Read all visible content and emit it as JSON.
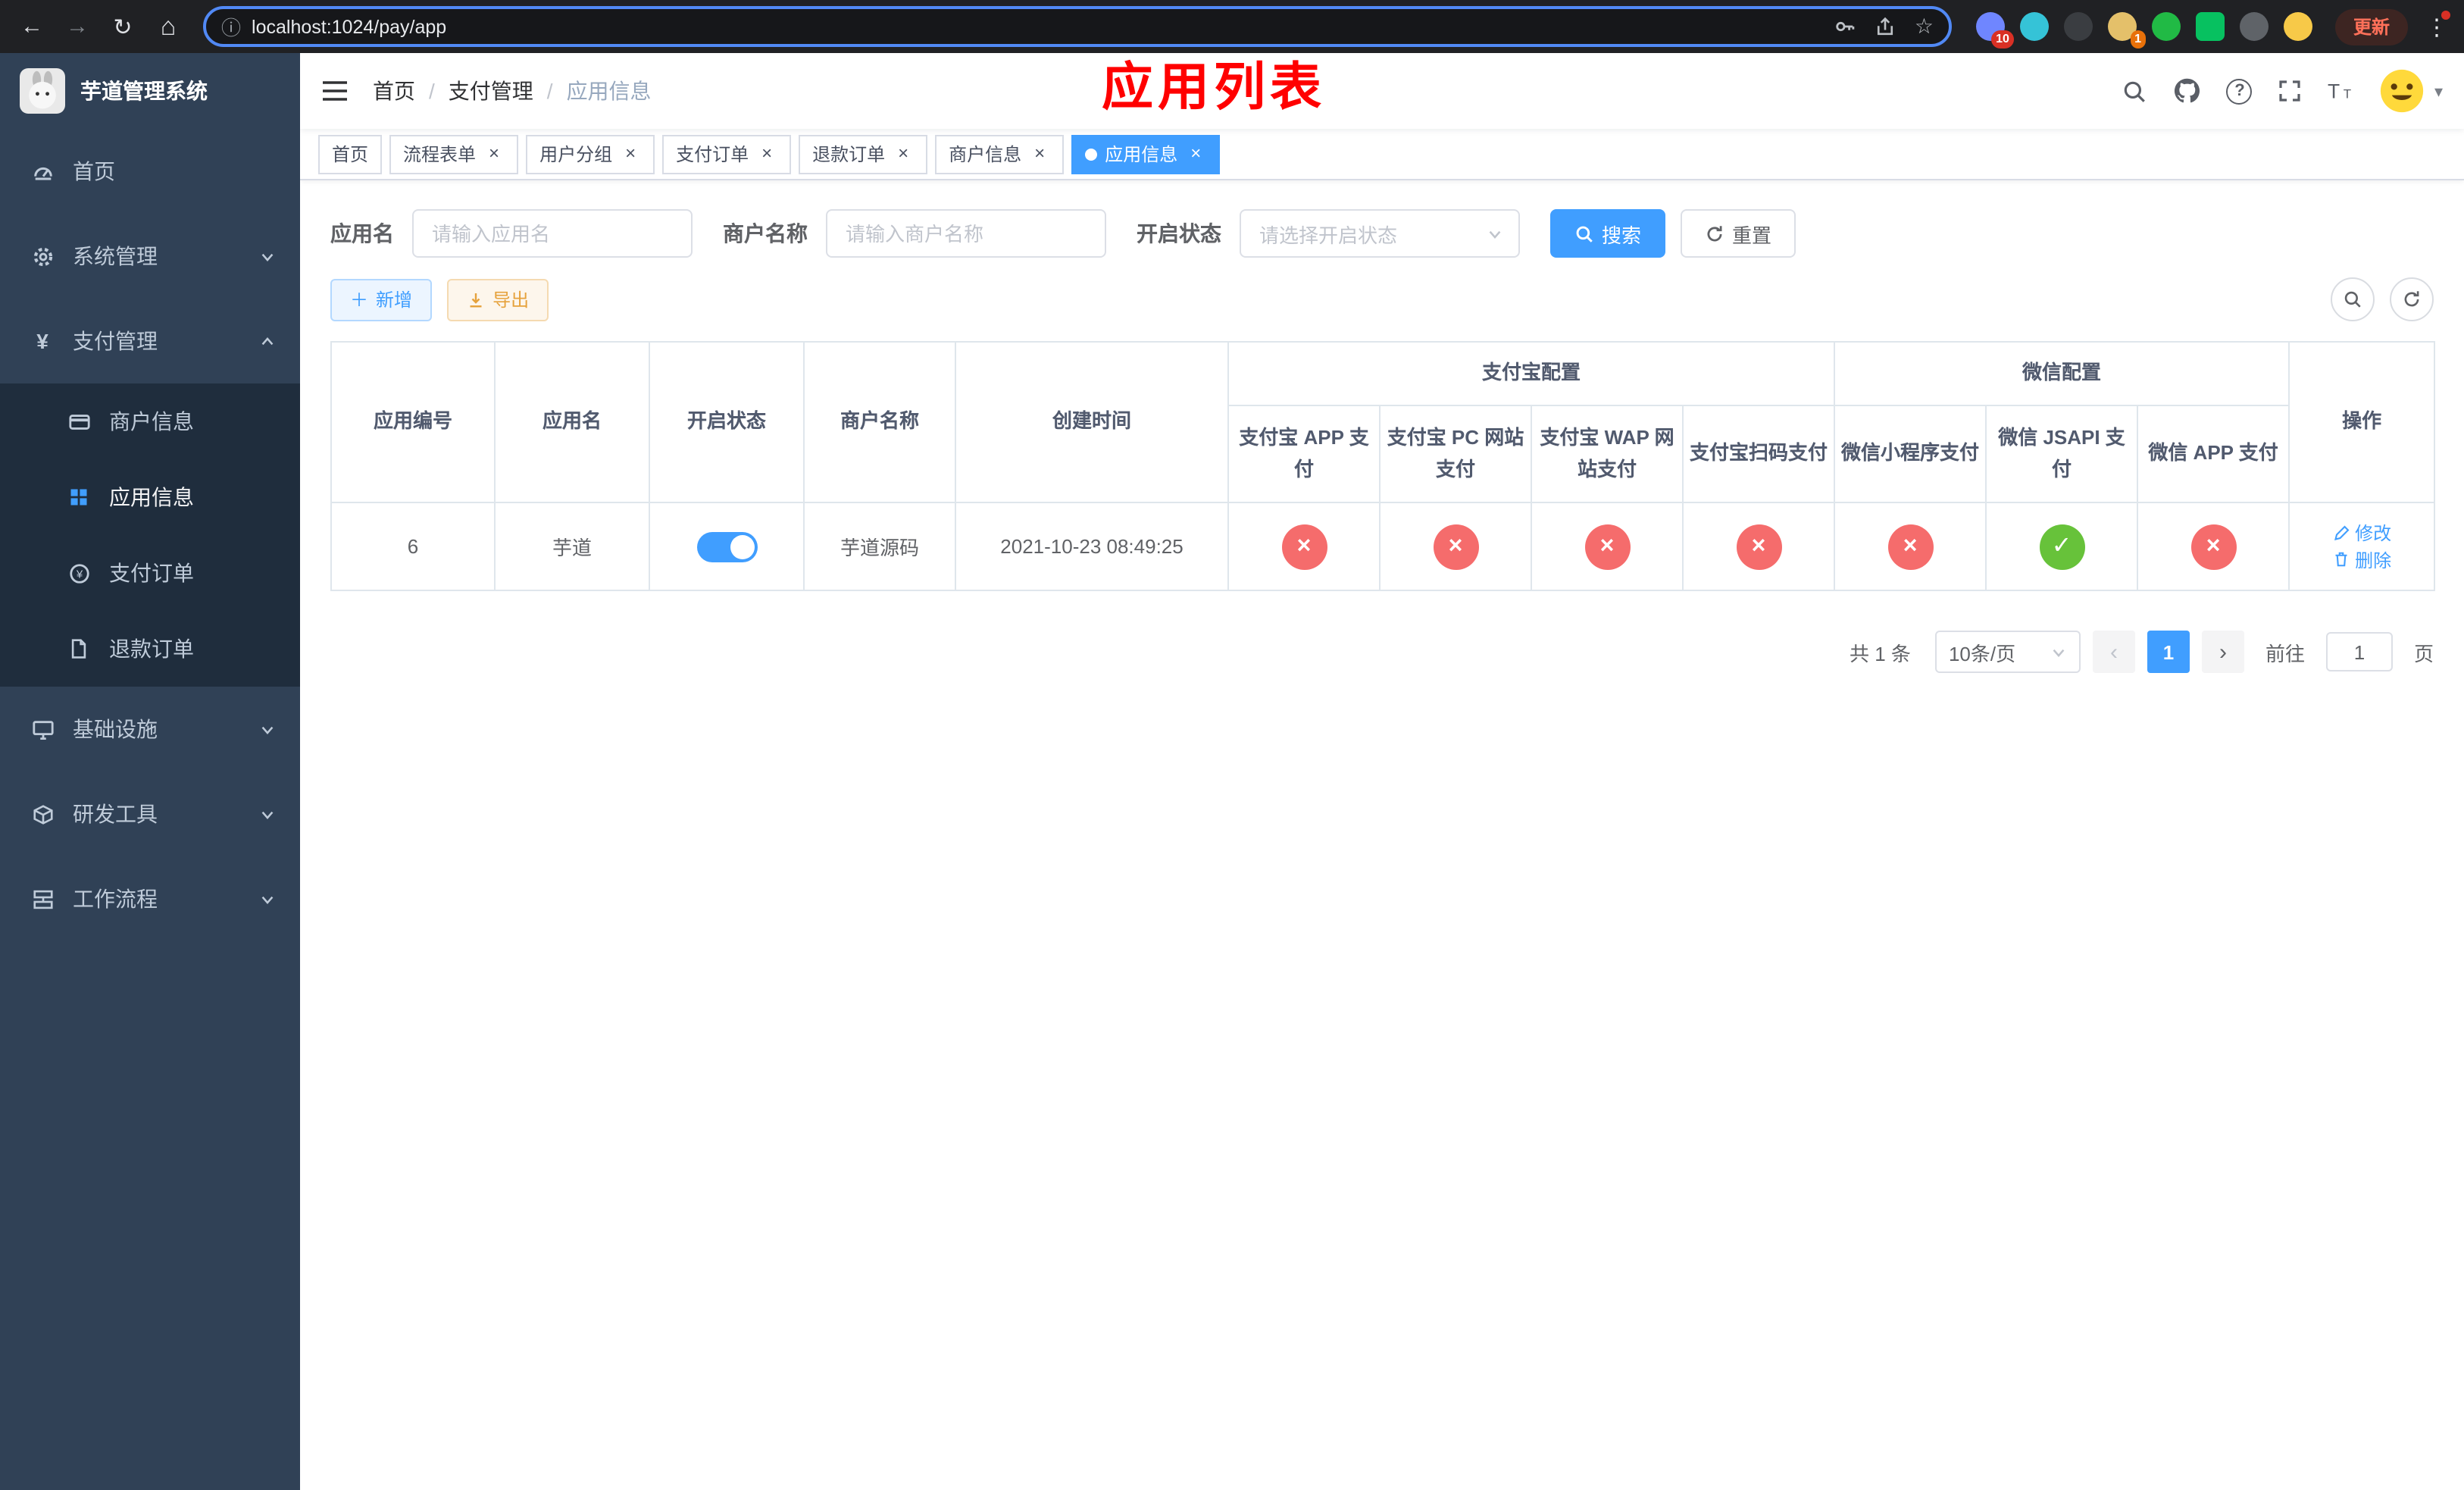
{
  "colors": {
    "accent": "#409eff",
    "success": "#67c23a",
    "danger": "#f56c6c",
    "warning": "#e6a23c",
    "sidebar_bg": "#304156",
    "submenu_bg": "#1f2d3d",
    "annotation": "#ff0000"
  },
  "browser": {
    "url": "localhost:1024/pay/app",
    "update_label": "更新",
    "ext_badge_a": "10",
    "ext_badge_b": "1"
  },
  "sidebar": {
    "title": "芋道管理系统",
    "items": [
      {
        "label": "首页"
      },
      {
        "label": "系统管理"
      },
      {
        "label": "支付管理"
      },
      {
        "label": "基础设施"
      },
      {
        "label": "研发工具"
      },
      {
        "label": "工作流程"
      }
    ],
    "submenu": [
      {
        "label": "商户信息"
      },
      {
        "label": "应用信息",
        "active": true
      },
      {
        "label": "支付订单"
      },
      {
        "label": "退款订单"
      }
    ]
  },
  "header": {
    "breadcrumb": [
      "首页",
      "支付管理",
      "应用信息"
    ],
    "annotation": "应用列表"
  },
  "tabs": [
    {
      "label": "首页",
      "closable": false
    },
    {
      "label": "流程表单",
      "closable": true
    },
    {
      "label": "用户分组",
      "closable": true
    },
    {
      "label": "支付订单",
      "closable": true
    },
    {
      "label": "退款订单",
      "closable": true
    },
    {
      "label": "商户信息",
      "closable": true
    },
    {
      "label": "应用信息",
      "closable": true,
      "active": true
    }
  ],
  "filters": {
    "app_name_label": "应用名",
    "app_name_placeholder": "请输入应用名",
    "merchant_label": "商户名称",
    "merchant_placeholder": "请输入商户名称",
    "status_label": "开启状态",
    "status_placeholder": "请选择开启状态",
    "search_button": "搜索",
    "reset_button": "重置"
  },
  "toolbar": {
    "add_button": "新增",
    "export_button": "导出"
  },
  "table": {
    "headers": {
      "app_id": "应用编号",
      "app_name": "应用名",
      "status": "开启状态",
      "merchant": "商户名称",
      "created": "创建时间",
      "alipay_group": "支付宝配置",
      "wechat_group": "微信配置",
      "actions": "操作",
      "alipay_cols": [
        "支付宝 APP 支付",
        "支付宝 PC 网站支付",
        "支付宝 WAP 网站支付",
        "支付宝扫码支付"
      ],
      "wechat_cols": [
        "微信小程序支付",
        "微信 JSAPI 支付",
        "微信 APP 支付"
      ]
    },
    "rows": [
      {
        "app_id": "6",
        "app_name": "芋道",
        "status_on": true,
        "merchant": "芋道源码",
        "created": "2021-10-23 08:49:25",
        "configs": [
          "error",
          "error",
          "error",
          "error",
          "error",
          "success",
          "error"
        ],
        "edit_label": "修改",
        "delete_label": "删除"
      }
    ]
  },
  "pagination": {
    "total_text": "共 1 条",
    "page_size": "10条/页",
    "current_page": "1",
    "goto_label": "前往",
    "goto_value": "1",
    "goto_unit": "页"
  }
}
